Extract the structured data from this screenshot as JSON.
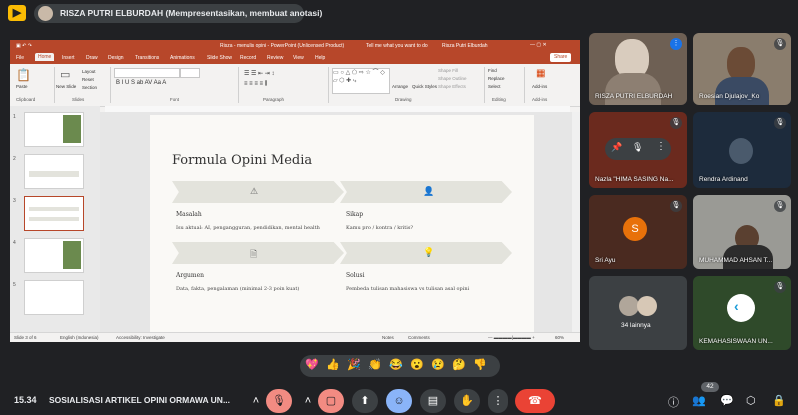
{
  "presenter": {
    "label": "RISZA PUTRI ELBURDAH (Mempresentasikan, membuat anotasi)"
  },
  "ppt": {
    "window_title": "Risza - menulis opini - PowerPoint (Unlicensed Product)",
    "tell_me": "Tell me what you want to do",
    "user": "Risza Putri Elburdah",
    "share": "Share",
    "tabs": [
      "File",
      "Home",
      "Insert",
      "Draw",
      "Design",
      "Transitions",
      "Animations",
      "Slide Show",
      "Record",
      "Review",
      "View",
      "Help"
    ],
    "ribbon_groups": [
      "Clipboard",
      "Slides",
      "Font",
      "Paragraph",
      "Drawing",
      "Editing",
      "Add-ins"
    ],
    "ribbon_buttons": {
      "paste": "Paste",
      "new_slide": "New Slide",
      "layout": "Layout",
      "reset": "Reset",
      "section": "Section",
      "arrange": "Arrange",
      "quick_styles": "Quick Styles",
      "shape_fill": "Shape Fill",
      "shape_outline": "Shape Outline",
      "shape_effects": "Shape Effects",
      "find": "Find",
      "replace": "Replace",
      "select": "Select",
      "add_ins": "Add-ins"
    },
    "slide_numbers": [
      "1",
      "2",
      "3",
      "4",
      "5"
    ],
    "status": {
      "slide": "Slide 3 of 6",
      "language": "English (Indonesia)",
      "accessibility": "Accessibility: Investigate",
      "notes": "Notes",
      "comments": "Comments",
      "zoom": "60%"
    }
  },
  "slide": {
    "title": "Formula Opini Media",
    "sections": [
      {
        "head": "Masalah",
        "body": "Isu aktual: AI, pengangguran, pendidikan, mental health",
        "icon": "warning-icon"
      },
      {
        "head": "Sikap",
        "body": "Kamu pro / kontra / kritis?",
        "icon": "user-icon"
      },
      {
        "head": "Argumen",
        "body": "Data, fakta, pengalaman (minimal 2-3 poin kuat)",
        "icon": "document-icon"
      },
      {
        "head": "Solusi",
        "body": "Pembeda tulisan mahasiswa vs tulisan asal opini",
        "icon": "lightbulb-icon"
      }
    ]
  },
  "participants": [
    {
      "name": "RISZA PUTRI ELBURDAH",
      "type": "video",
      "corner": "audio-active-icon"
    },
    {
      "name": "Roesian Djulajov_Ko",
      "type": "video",
      "corner": "mic-off-icon"
    },
    {
      "name": "Nazla \"HIMA SASING Na...",
      "type": "video",
      "corner": "mic-off-icon"
    },
    {
      "name": "Rendra Ardinand",
      "type": "video",
      "corner": "mic-off-icon"
    },
    {
      "name": "Sri Ayu",
      "type": "avatar",
      "initial": "S",
      "corner": "mic-off-icon"
    },
    {
      "name": "MUHAMMAD AHSAN T...",
      "type": "video",
      "corner": "mic-off-icon"
    },
    {
      "name": "34 lainnya",
      "type": "others"
    },
    {
      "name": "KEMAHASISWAAN UN...",
      "type": "logo",
      "corner": "mic-off-icon"
    }
  ],
  "reactions": [
    "💖",
    "👍",
    "🎉",
    "👏",
    "😂",
    "😮",
    "😢",
    "🤔",
    "👎"
  ],
  "bottom": {
    "clock": "15.34",
    "meeting_title": "SOSIALISASI ARTIKEL OPINI ORMAWA UN...",
    "participant_count": "42"
  },
  "colors": {
    "ppt_accent": "#b7472a",
    "meet_bg": "#202124",
    "mic_off": "#f28b82",
    "active": "#8ab4f8",
    "end_call": "#ea4335",
    "avatar_orange": "#e8710a"
  }
}
